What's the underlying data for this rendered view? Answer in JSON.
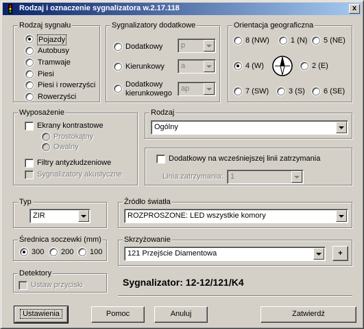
{
  "window": {
    "title": "Rodzaj i oznaczenie sygnalizatora w.2.17.118",
    "close_label": "x"
  },
  "rodzaj_sygnalu": {
    "legend": "Rodzaj sygnału",
    "options": [
      "Pojazdy",
      "Autobusy",
      "Tramwaje",
      "Piesi",
      "Piesi i rowerzyści",
      "Rowerzyści"
    ],
    "selected": "Pojazdy"
  },
  "sygnalizatory_dodatkowe": {
    "legend": "Sygnalizatory dodatkowe",
    "items": [
      {
        "label": "Dodatkowy",
        "value": "p"
      },
      {
        "label": "Kierunkowy",
        "value": "a"
      },
      {
        "label": "Dodatkowy",
        "label2": "kierunkowego",
        "value": "ap"
      }
    ]
  },
  "orientacja": {
    "legend": "Orientacja geograficzna",
    "options": [
      "8 (NW)",
      "1 (N)",
      "5 (NE)",
      "4 (W)",
      "2 (E)",
      "7 (SW)",
      "3 (S)",
      "6 (SE)"
    ],
    "selected": "4 (W)"
  },
  "wyposazenie": {
    "legend": "Wyposażenie",
    "ekrany": "Ekrany kontrastowe",
    "prostokatny": "Prostokątny",
    "owalny": "Owalny",
    "filtry": "Filtry antyzłudzeniowe",
    "akustyczne": "Sygnalizatory akustyczne"
  },
  "rodzaj": {
    "legend": "Rodzaj",
    "value": "Ogólny"
  },
  "dodatkowy_linia": {
    "checkbox_label": "Dodatkowy na wcześniejszej linii zatrzymania",
    "linia_label": "Linia zatrzymania:",
    "linia_value": "1"
  },
  "typ": {
    "legend": "Typ",
    "value": "ZIR"
  },
  "zrodlo": {
    "legend": "Źródło światła",
    "value": "ROZPROSZONE: LED wszystkie komory"
  },
  "srednica": {
    "legend": "Średnica soczewki (mm)",
    "options": [
      "300",
      "200",
      "100"
    ],
    "selected": "300"
  },
  "skrzyzowanie": {
    "legend": "Skrzyżowanie",
    "value": "121 Przejście Diamentowa",
    "add_label": "+"
  },
  "detektory": {
    "legend": "Detektory",
    "ustaw": "Ustaw przyciski"
  },
  "sygnalizator_text": "Sygnalizator: 12-12/121/K4",
  "buttons": {
    "ustawienia": "Ustawienia",
    "pomoc": "Pomoc",
    "anuluj": "Anuluj",
    "zatwierdz": "Zatwierdź"
  }
}
